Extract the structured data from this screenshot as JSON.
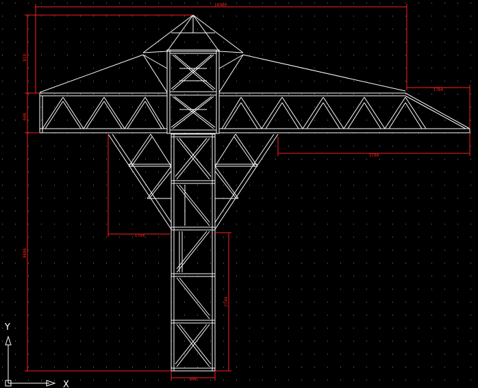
{
  "drawing": {
    "background_color": "#000000",
    "line_color": "#ffffff",
    "dimension_color": "#ff2020",
    "grid_dots": true
  },
  "dimensions": {
    "overall_width": "16960",
    "apex_height": "819",
    "jib_depth": "646",
    "tip_offset": "1764",
    "tower_offset_right": "3790",
    "tower_offset_left": "1764",
    "total_height": "9486",
    "section_height": "2749",
    "mast_width": "840"
  },
  "ucs_icon": {
    "x_label": "X",
    "y_label": "Y"
  }
}
